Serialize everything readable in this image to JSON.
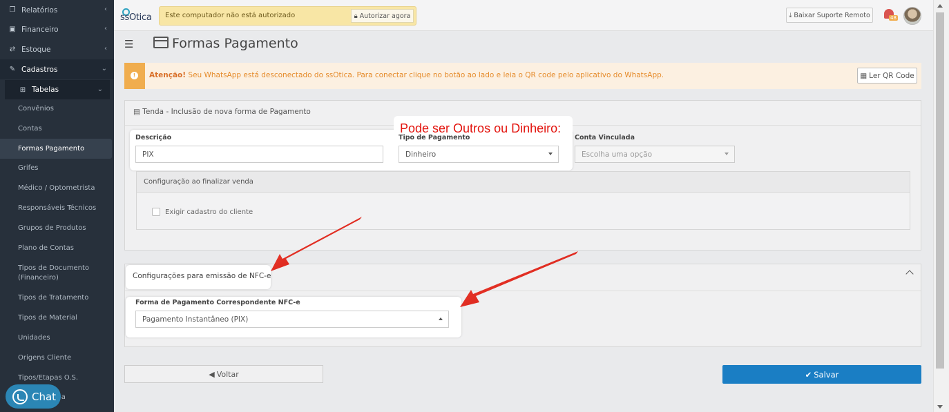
{
  "sidebar": {
    "items": [
      {
        "label": "Relatórios",
        "icon": "copy-icon"
      },
      {
        "label": "Financeiro",
        "icon": "money-icon"
      },
      {
        "label": "Estoque",
        "icon": "exchange-icon"
      },
      {
        "label": "Cadastros",
        "icon": "edit-icon"
      }
    ],
    "tabelas": {
      "label": "Tabelas",
      "icon": "table-icon"
    },
    "subitems": [
      "Convênios",
      "Contas",
      "Formas Pagamento",
      "Grifes",
      "Médico / Optometrista",
      "Responsáveis Técnicos",
      "Grupos de Produtos",
      "Plano de Contas",
      "Tipos de Documento (Financeiro)",
      "Tipos de Tratamento",
      "Tipos de Material",
      "Unidades",
      "Origens Cliente",
      "Tipos/Etapas O.S.",
      "ntas a"
    ],
    "active_index": 2,
    "chat_label": "Chat"
  },
  "topbar": {
    "logo_text": "ssOtica",
    "auth_message": "Este computador não está autorizado",
    "auth_button": "Autorizar agora",
    "remote_button": "Baixar Suporte Remoto",
    "notification_count": "48"
  },
  "page": {
    "title": "Formas Pagamento"
  },
  "alert": {
    "strong": "Atenção!",
    "text": " Seu WhatsApp está desconectado do ssOtica. Para conectar clique no botão ao lado e leia o QR code pelo aplicativo do WhatsApp.",
    "button": "Ler QR Code"
  },
  "form": {
    "header": "Tenda - Inclusão de nova forma de Pagamento",
    "descricao_label": "Descrição",
    "descricao_value": "PIX",
    "tipo_label": "Tipo de Pagamento",
    "tipo_value": "Dinheiro",
    "conta_label": "Conta Vinculada",
    "conta_placeholder": "Escolha uma opção",
    "config_header": "Configuração ao finalizar venda",
    "exigir_label": "Exigir cadastro do cliente"
  },
  "nfce": {
    "header": "Configurações para emissão de NFC-e",
    "label": "Forma de Pagamento Correspondente NFC-e",
    "value": "Pagamento Instantâneo (PIX)"
  },
  "buttons": {
    "voltar": "Voltar",
    "salvar": "Salvar"
  },
  "annotation": "Pode ser Outros ou Dinheiro:",
  "colors": {
    "sidebar_bg": "#27303b",
    "primary": "#1a7ec4",
    "warning": "#f0ad4e",
    "annotation_red": "#e3150f"
  }
}
